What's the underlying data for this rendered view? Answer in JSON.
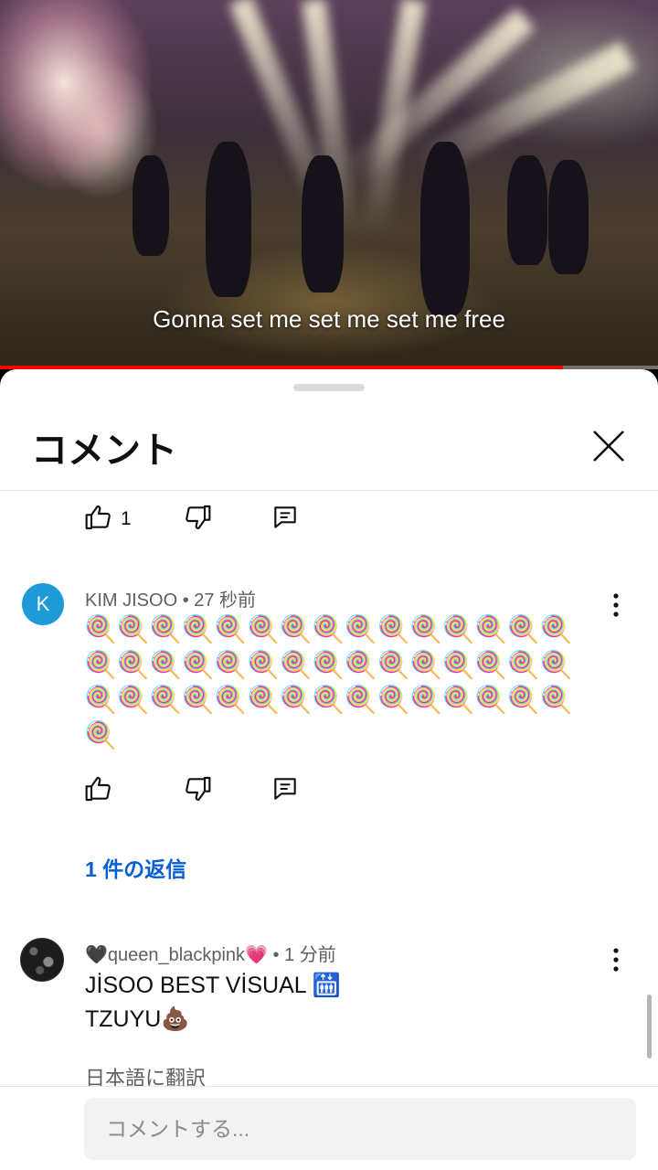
{
  "video": {
    "subtitle": "Gonna set me set me set me free",
    "progress_percent": 85.6,
    "progress_color": "#ff0000"
  },
  "comments_panel": {
    "title": "コメント",
    "close_icon": "close-icon",
    "prev_comment_actions": {
      "like_count": "1",
      "icons": [
        "thumbs-up-icon",
        "thumbs-down-icon",
        "reply-icon"
      ]
    },
    "comments": [
      {
        "avatar_letter": "K",
        "avatar_color": "#1e9ad6",
        "author": "KIM JISOO",
        "time": "• 27 秒前",
        "text": "🍭🍭🍭🍭🍭🍭🍭🍭🍭🍭🍭🍭🍭🍭🍭🍭🍭🍭🍭🍭🍭🍭🍭🍭🍭🍭🍭🍭🍭🍭🍭🍭🍭🍭🍭🍭🍭🍭🍭🍭🍭🍭🍭🍭🍭🍭",
        "replies_label": "1 件の返信",
        "accent_color": "#065fd4"
      },
      {
        "author": "🖤queen_blackpink💗",
        "time": "• 1 分前",
        "line1": "JİSOO BEST VİSUAL 🛗",
        "line2": "TZUYU💩",
        "translate_label": "日本語に翻訳"
      }
    ],
    "input": {
      "placeholder": "コメントする..."
    }
  }
}
